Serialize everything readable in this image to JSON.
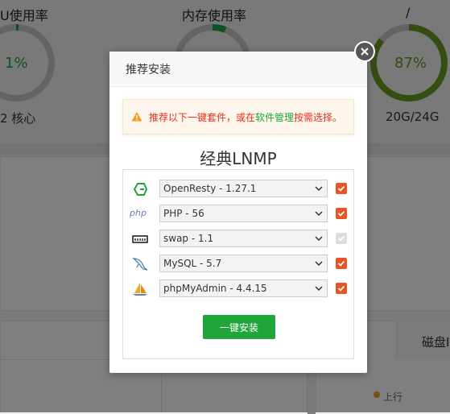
{
  "background": {
    "cpu": {
      "title": "U使用率",
      "value": "1%",
      "sub": "2 核心",
      "percent": 1
    },
    "memory": {
      "title": "内存使用率"
    },
    "disk": {
      "title": "/",
      "value": "87%",
      "sub": "20G/24G",
      "percent": 87
    },
    "tab_disk": "磁盘I",
    "legend_up": "上行",
    "colors": {
      "green": "#20a53a",
      "disk_green": "#6a9a23",
      "gray_ring": "#c8c8c8",
      "legend": "#e0a526"
    }
  },
  "modal": {
    "title": "推荐安装",
    "alert": {
      "prefix": "推荐以下一键套件，或在",
      "link": "软件管理",
      "suffix": "按需选择。",
      "icon": "warning-icon"
    },
    "suite_title": "经典LNMP",
    "packages": [
      {
        "icon": "openresty-icon",
        "option": "OpenResty - 1.27.1",
        "checked": true,
        "disabled": false
      },
      {
        "icon": "php-icon",
        "icon_text": "php",
        "option": "PHP - 56",
        "checked": true,
        "disabled": false
      },
      {
        "icon": "memory-chip-icon",
        "option": "swap - 1.1",
        "checked": true,
        "disabled": true
      },
      {
        "icon": "mysql-dolphin-icon",
        "option": "MySQL - 5.7",
        "checked": true,
        "disabled": false
      },
      {
        "icon": "phpmyadmin-sail-icon",
        "option": "phpMyAdmin - 4.4.15",
        "checked": true,
        "disabled": false
      }
    ],
    "install_button": "一键安装",
    "close_icon": "close-icon",
    "colors": {
      "check": "#e85424",
      "button": "#20a53a",
      "alert_text": "#e8301c"
    }
  }
}
